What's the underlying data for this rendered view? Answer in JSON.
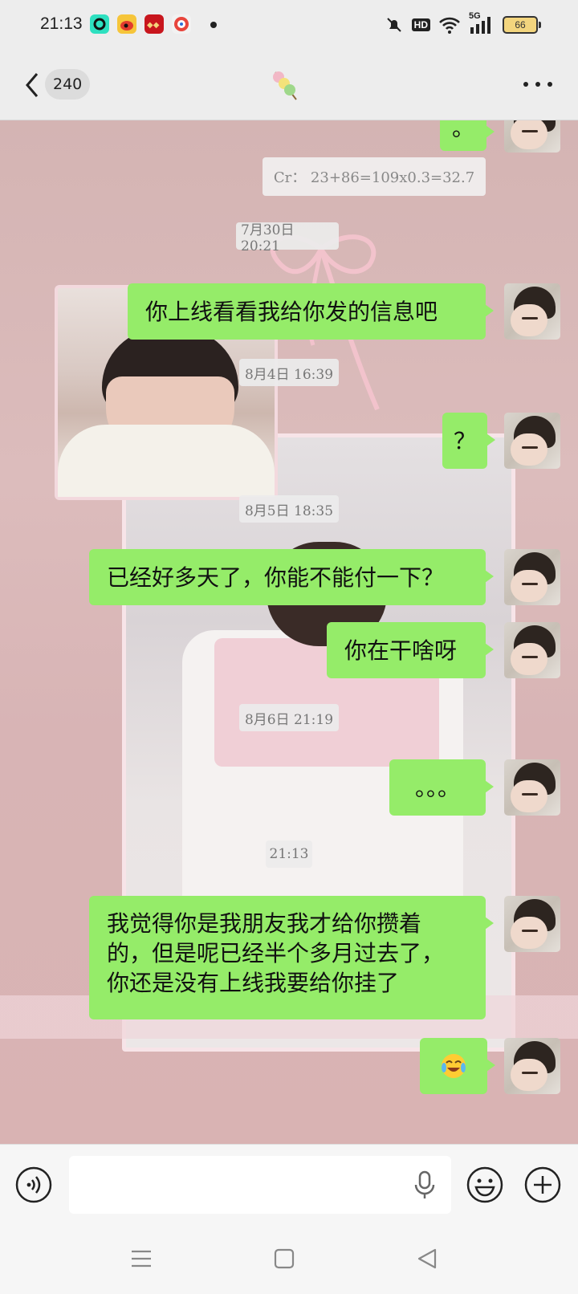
{
  "status_bar": {
    "time": "21:13",
    "network": "5G",
    "hd": "HD",
    "battery": "66"
  },
  "header": {
    "unread_count": "240",
    "title_icon": "tanghulu-icon",
    "more_icon": "more-icon"
  },
  "messages": {
    "note": "Cr： 23+86=109x0.3=32.7",
    "ts1": "7月30日 20:21",
    "m1": "你上线看看我给你发的信息吧",
    "ts2": "8月4日 16:39",
    "m2": "？",
    "ts3": "8月5日 18:35",
    "m3": "已经好多天了，你能不能付一下？",
    "m4": "你在干啥呀",
    "ts4": "8月6日 21:19",
    "m5": "。。。",
    "ts5": "21:13",
    "m6": "我觉得你是我朋友我才给你攒着的，但是呢已经半个多月过去了，你还是没有上线我要给你挂了",
    "m6_line1": "我觉得你是我朋友我才给你攒着",
    "m6_line2": "的，但是呢已经半个多月过去了，",
    "m6_line3": "你还是没有上线我要给你挂了",
    "m7_emoji": "crying-laughing-emoji",
    "top_partial": "。"
  },
  "input": {
    "value": "",
    "placeholder": ""
  },
  "colors": {
    "bubble": "#95ec69",
    "bar": "#ededed",
    "chat_bg": "#d8b6b6"
  }
}
